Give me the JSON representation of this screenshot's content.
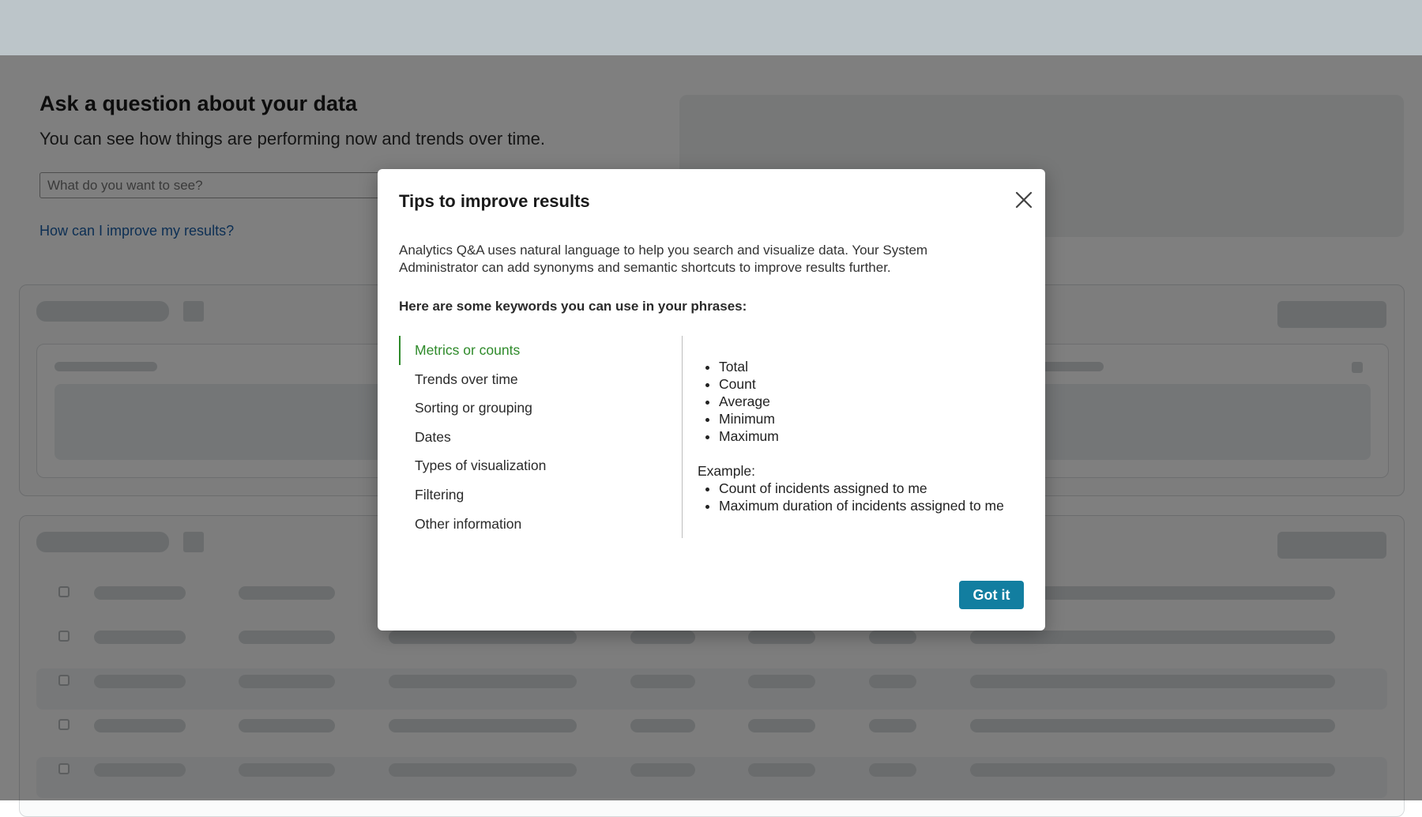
{
  "page": {
    "title": "Ask a question about your data",
    "subtitle": "You can see how things are performing now and trends over time.",
    "search_placeholder": "What do you want to see?",
    "help_link": "How can I improve my results?"
  },
  "modal": {
    "title": "Tips to improve results",
    "description": "Analytics Q&A uses natural language to help you search and visualize data. Your System Administrator can add synonyms and semantic shortcuts to improve results further.",
    "keywords_heading": "Here are some keywords you can use in your phrases:",
    "categories": [
      {
        "label": "Metrics or counts",
        "active": true
      },
      {
        "label": "Trends over time",
        "active": false
      },
      {
        "label": "Sorting or grouping",
        "active": false
      },
      {
        "label": "Dates",
        "active": false
      },
      {
        "label": "Types of visualization",
        "active": false
      },
      {
        "label": "Filtering",
        "active": false
      },
      {
        "label": "Other information",
        "active": false
      }
    ],
    "keywords": [
      "Total",
      "Count",
      "Average",
      "Minimum",
      "Maximum"
    ],
    "example_label": "Example:",
    "examples": [
      "Count of incidents assigned to me",
      "Maximum duration of incidents assigned to me"
    ],
    "got_it_label": "Got it"
  },
  "colors": {
    "accent_active": "#2e8a2a",
    "primary_button": "#127ea0",
    "link": "#1a5fa8"
  }
}
